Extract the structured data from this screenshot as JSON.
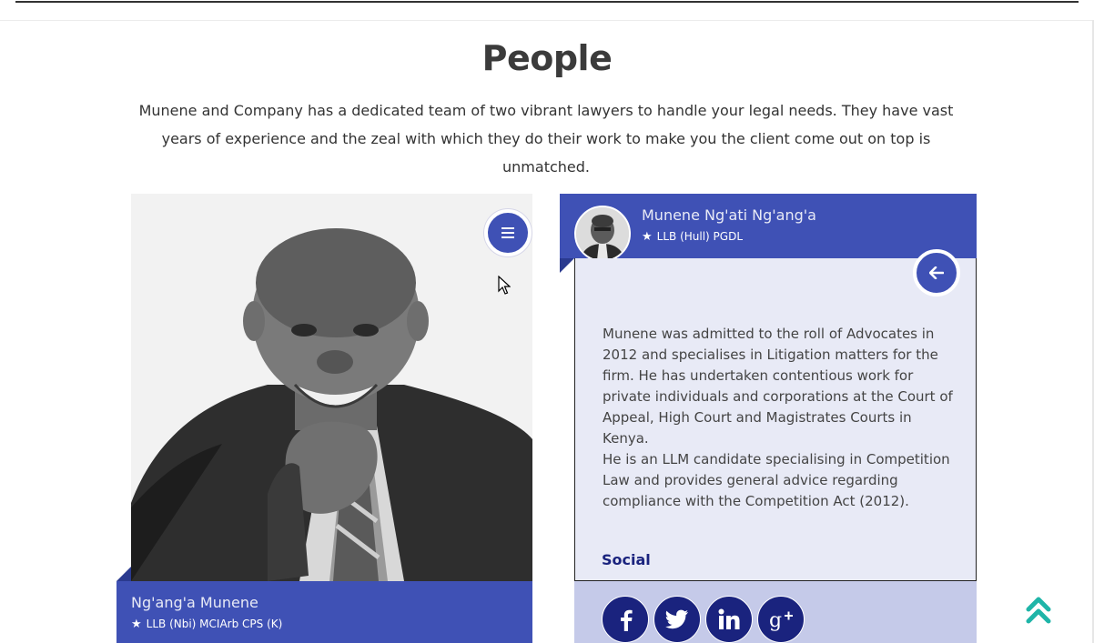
{
  "page": {
    "title": "People",
    "intro": "Munene and Company has a dedicated team of two vibrant lawyers to handle your legal needs. They have vast years of experience and the zeal with which they do their work to make you the client come out on top is unmatched."
  },
  "people": [
    {
      "name": "Ng'ang'a Munene",
      "qualifications": "LLB (Nbi) MCIArb CPS (K)"
    },
    {
      "name": "Munene Ng'ati Ng'ang'a",
      "qualifications": "LLB (Hull) PGDL",
      "bio": [
        "Munene was admitted to the roll of Advocates in 2012 and specialises in Litigation matters for the firm. He has undertaken contentious work for private individuals and corporations at the Court of Appeal, High Court and Magistrates Courts in Kenya.",
        "He is an LLM candidate specialising in Competition Law and provides general advice regarding compliance with the Competition Act (2012)."
      ],
      "social_label": "Social"
    }
  ],
  "icons": {
    "menu": "menu-icon",
    "back": "arrow-left-icon",
    "star": "star-icon",
    "scroll_top": "double-chevron-up-icon",
    "social": [
      "facebook-icon",
      "twitter-icon",
      "linkedin-icon",
      "google-plus-icon"
    ]
  },
  "colors": {
    "primary": "#3f51b5",
    "dark": "#1a237e",
    "panel": "#e8eaf6",
    "social_bar": "#c5cae9",
    "scroll_top": "#1fb5a8"
  }
}
